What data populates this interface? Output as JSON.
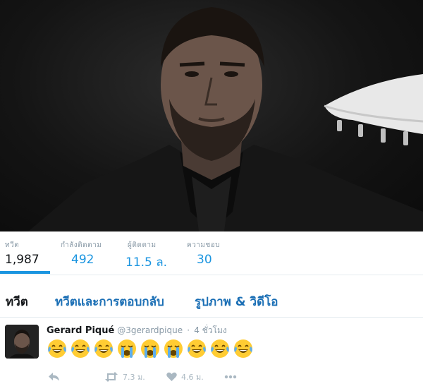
{
  "header": {
    "image": "profile-header-photo"
  },
  "stats": [
    {
      "label": "ทวีต",
      "value": "1,987"
    },
    {
      "label": "กำลังติดตาม",
      "value": "492"
    },
    {
      "label": "ผู้ติดตาม",
      "value": "11.5 ล."
    },
    {
      "label": "ความชอบ",
      "value": "30"
    }
  ],
  "tabs": [
    {
      "label": "ทวีต"
    },
    {
      "label": "ทวีตและการตอบกลับ"
    },
    {
      "label": "รูปภาพ & วิดีโอ"
    }
  ],
  "tweet": {
    "author_name": "Gerard Piqué",
    "author_handle": "@3gerardpique",
    "separator": "·",
    "time": "4 ชั่วโมง",
    "emojis": [
      "joy-emoji",
      "joy-emoji",
      "joy-emoji",
      "sob-emoji",
      "sob-emoji",
      "sob-emoji",
      "joy-emoji",
      "joy-emoji",
      "joy-emoji"
    ],
    "actions": {
      "reply_icon": "reply-icon",
      "retweet_count": "7.3 ม.",
      "like_count": "4.6 ม.",
      "more_icon": "more-icon"
    }
  },
  "colors": {
    "accent": "#1b95e0",
    "tab_link": "#1b6fb5",
    "muted": "#8899a6",
    "action_gray": "#aab8c2",
    "emoji_yellow": "#ffcc33",
    "tear_blue": "#5dadec"
  }
}
